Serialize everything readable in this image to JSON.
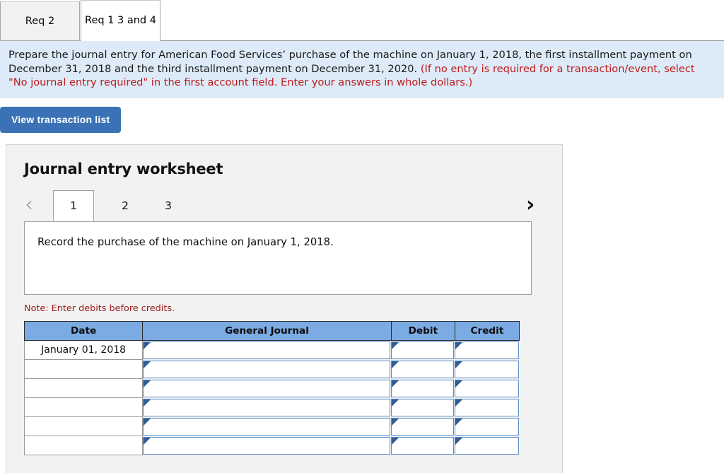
{
  "req_tabs": [
    {
      "label": "Req 2",
      "active": false
    },
    {
      "label": "Req 1 3 and 4",
      "active": true
    }
  ],
  "instructions": {
    "main": "Prepare the journal entry for American Food Services’ purchase of the machine on January 1, 2018, the first installment payment on December 31, 2018 and the third installment payment on December 31, 2020.",
    "hint": "(If no entry is required for a transaction/event, select \"No journal entry required\" in the first account field. Enter your answers in whole dollars.)",
    "background_color": "#dcebf7",
    "hint_color": "#c0191b"
  },
  "toolbar": {
    "view_transaction_list_label": "View transaction list",
    "button_color": "#3b72b5"
  },
  "worksheet": {
    "title": "Journal entry worksheet",
    "pager": {
      "prev_icon": "chevron-left-icon",
      "next_icon": "chevron-right-icon",
      "prev_enabled": false,
      "next_enabled": true,
      "tabs": [
        {
          "label": "1",
          "active": true
        },
        {
          "label": "2",
          "active": false
        },
        {
          "label": "3",
          "active": false
        }
      ]
    },
    "description": "Record the purchase of the machine on January 1, 2018.",
    "note": "Note: Enter debits before credits.",
    "note_color": "#9c1b1b",
    "table": {
      "header_color": "#7caae2",
      "columns": [
        "Date",
        "General Journal",
        "Debit",
        "Credit"
      ],
      "rows": [
        {
          "date": "January 01, 2018",
          "general_journal": "",
          "debit": "",
          "credit": ""
        },
        {
          "date": "",
          "general_journal": "",
          "debit": "",
          "credit": ""
        },
        {
          "date": "",
          "general_journal": "",
          "debit": "",
          "credit": ""
        },
        {
          "date": "",
          "general_journal": "",
          "debit": "",
          "credit": ""
        },
        {
          "date": "",
          "general_journal": "",
          "debit": "",
          "credit": ""
        },
        {
          "date": "",
          "general_journal": "",
          "debit": "",
          "credit": ""
        }
      ]
    }
  }
}
